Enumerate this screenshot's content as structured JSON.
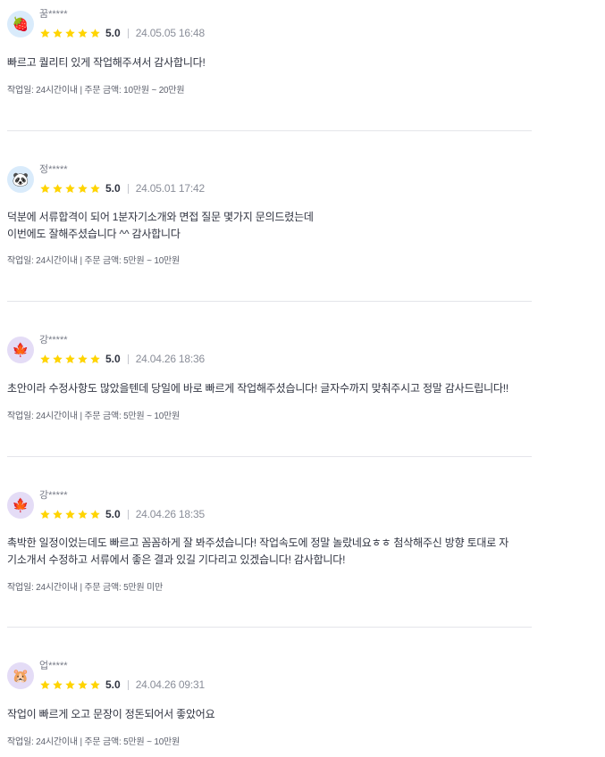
{
  "reviews": [
    {
      "avatar_icon": "strawberry-icon",
      "avatar_bg": "#d9ebfb",
      "avatar_glyph": "🍓",
      "username": "꿈*****",
      "score": "5.0",
      "rating": 5,
      "date": "24.05.05 16:48",
      "body": "빠르고 퀄리티 있게 작업해주셔서 감사합니다!",
      "info": "작업일: 24시간이내 | 주문 금액: 10만원 ~ 20만원"
    },
    {
      "avatar_icon": "panda-icon",
      "avatar_bg": "#d9ebfb",
      "avatar_glyph": "🐼",
      "username": "정*****",
      "score": "5.0",
      "rating": 5,
      "date": "24.05.01 17:42",
      "body": "덕분에 서류합격이 되어 1분자기소개와 면접 질문 몇가지 문의드렸는데\n이번에도 잘해주셨습니다 ^^ 감사합니다",
      "info": "작업일: 24시간이내 | 주문 금액: 5만원 ~ 10만원"
    },
    {
      "avatar_icon": "maple-leaf-icon",
      "avatar_bg": "#e4dcf6",
      "avatar_glyph": "🍁",
      "username": "강*****",
      "score": "5.0",
      "rating": 5,
      "date": "24.04.26 18:36",
      "body": "초안이라 수정사항도 많았을텐데 당일에 바로 빠르게 작업해주셨습니다! 글자수까지 맞춰주시고 정말 감사드립니다!!",
      "info": "작업일: 24시간이내 | 주문 금액: 5만원 ~ 10만원"
    },
    {
      "avatar_icon": "maple-leaf-icon",
      "avatar_bg": "#e4dcf6",
      "avatar_glyph": "🍁",
      "username": "강*****",
      "score": "5.0",
      "rating": 5,
      "date": "24.04.26 18:35",
      "body": "촉박한 일정이었는데도 빠르고 꼼꼼하게 잘 봐주셨습니다! 작업속도에 정말 놀랐네요ㅎㅎ 첨삭해주신 방향 토대로 자\n기소개서 수정하고 서류에서 좋은 결과 있길 기다리고 있겠습니다! 감사합니다!",
      "info": "작업일: 24시간이내 | 주문 금액: 5만원 미만"
    },
    {
      "avatar_icon": "hamster-icon",
      "avatar_bg": "#e4dcf6",
      "avatar_glyph": "🐹",
      "username": "업*****",
      "score": "5.0",
      "rating": 5,
      "date": "24.04.26 09:31",
      "body": "작업이 빠르게 오고 문장이 정돈되어서 좋았어요",
      "info": "작업일: 24시간이내 | 주문 금액: 5만원 ~ 10만원"
    }
  ],
  "colors": {
    "star": "#ffd400"
  }
}
